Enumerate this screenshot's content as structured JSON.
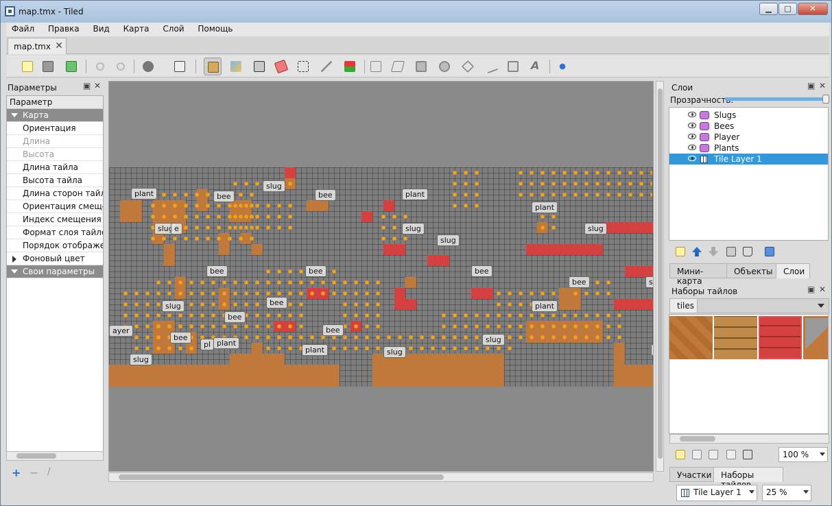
{
  "window": {
    "title": "map.tmx - Tiled",
    "controls": {
      "minimize": "▁",
      "maximize": "□",
      "close": "✕"
    }
  },
  "menu": [
    "Файл",
    "Правка",
    "Вид",
    "Карта",
    "Слой",
    "Помощь"
  ],
  "document_tab": {
    "label": "map.tmx",
    "close": "✕"
  },
  "toolbar": {
    "tools": [
      "new-icon",
      "open-icon",
      "save-icon",
      "undo-icon",
      "redo-icon",
      "random-icon",
      "dice-icon",
      "stamp-icon",
      "terrain-brush-icon",
      "bucket-fill-icon",
      "eraser-icon",
      "rect-select-icon",
      "magic-wand-icon",
      "select-same-tile-icon",
      "object-select-icon",
      "edit-polygon-icon",
      "insert-rect-icon",
      "insert-ellipse-icon",
      "insert-polygon-icon",
      "insert-polyline-icon",
      "insert-tile-icon",
      "insert-text-icon",
      "move-icon"
    ]
  },
  "properties_panel": {
    "title": "Параметры",
    "header": "Параметр",
    "rows": [
      {
        "label": "Карта",
        "kind": "group"
      },
      {
        "label": "Ориентация",
        "kind": "normal"
      },
      {
        "label": "Длина",
        "kind": "disabled"
      },
      {
        "label": "Высота",
        "kind": "disabled"
      },
      {
        "label": "Длина тайла",
        "kind": "normal"
      },
      {
        "label": "Высота тайла",
        "kind": "normal"
      },
      {
        "label": "Длина сторон тайла (",
        "kind": "normal"
      },
      {
        "label": "Ориентация смещени",
        "kind": "normal"
      },
      {
        "label": "Индекс смещения",
        "kind": "normal"
      },
      {
        "label": "Формат слоя тайлов",
        "kind": "normal"
      },
      {
        "label": "Порядок отображени",
        "kind": "normal"
      },
      {
        "label": "Фоновый цвет",
        "kind": "collapsed"
      },
      {
        "label": "Свои параметры",
        "kind": "group"
      }
    ],
    "buttons": {
      "add": "+",
      "remove": "−",
      "edit": "/"
    }
  },
  "map_labels": [
    {
      "text": "plant"
    },
    {
      "text": "slug"
    },
    {
      "text": "bee"
    },
    {
      "text": "plant"
    },
    {
      "text": "bee"
    },
    {
      "text": "plant"
    },
    {
      "text": "slug"
    },
    {
      "text": "slug"
    },
    {
      "text": "slug"
    },
    {
      "text": "slug"
    },
    {
      "text": "e"
    },
    {
      "text": "bee"
    },
    {
      "text": "bee"
    },
    {
      "text": "bee"
    },
    {
      "text": "bee"
    },
    {
      "text": "slug"
    },
    {
      "text": "bee"
    },
    {
      "text": "plant"
    },
    {
      "text": "bee"
    },
    {
      "text": "slu"
    },
    {
      "text": "ayer"
    },
    {
      "text": "bee"
    },
    {
      "text": "pl"
    },
    {
      "text": "plant"
    },
    {
      "text": "bee"
    },
    {
      "text": "slug"
    },
    {
      "text": "plant"
    },
    {
      "text": "slug"
    },
    {
      "text": "slug"
    },
    {
      "text": "b"
    }
  ],
  "layers_panel": {
    "title": "Слои",
    "opacity_label": "Прозрачность:",
    "layers": [
      {
        "name": "Slugs",
        "type": "object",
        "selected": false
      },
      {
        "name": "Bees",
        "type": "object",
        "selected": false
      },
      {
        "name": "Player",
        "type": "object",
        "selected": false
      },
      {
        "name": "Plants",
        "type": "object",
        "selected": false
      },
      {
        "name": "Tile Layer 1",
        "type": "tile",
        "selected": true
      }
    ],
    "tabs": [
      "Мини-карта",
      "Объекты",
      "Слои"
    ]
  },
  "tilesets_panel": {
    "title": "Наборы тайлов",
    "tab": "tiles",
    "zoom": "100 %",
    "tabs": [
      "Участки",
      "Наборы тайлов"
    ]
  },
  "statusbar": {
    "layer": "Tile Layer 1",
    "zoom": "25 %"
  }
}
